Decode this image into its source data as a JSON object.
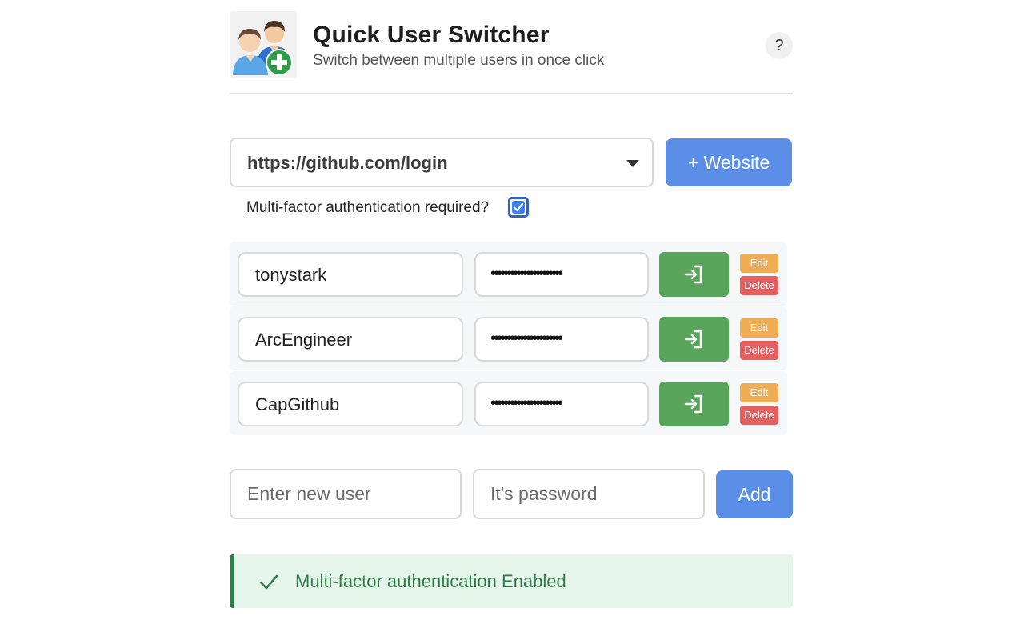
{
  "header": {
    "title": "Quick User Switcher",
    "subtitle": "Switch between multiple users in once click",
    "help_label": "?"
  },
  "website": {
    "selected": "https://github.com/login",
    "add_button_label": "+ Website"
  },
  "mfa": {
    "label": "Multi-factor authentication required?",
    "checked": true
  },
  "users": [
    {
      "username": "tonystark",
      "password_mask": "••••••••••••••••••••••",
      "edit_label": "Edit",
      "delete_label": "Delete"
    },
    {
      "username": "ArcEngineer",
      "password_mask": "••••••••••••••••••••••",
      "edit_label": "Edit",
      "delete_label": "Delete"
    },
    {
      "username": "CapGithub",
      "password_mask": "••••••••••••••••••••••",
      "edit_label": "Edit",
      "delete_label": "Delete"
    }
  ],
  "new_user": {
    "username_placeholder": "Enter new user",
    "password_placeholder": "It's password",
    "add_label": "Add"
  },
  "status": {
    "message": "Multi-factor authentication Enabled",
    "color": "#2e7d4a"
  },
  "colors": {
    "primary": "#5b8ee6",
    "login": "#5aa55c",
    "edit": "#efae56",
    "delete": "#e46060"
  }
}
